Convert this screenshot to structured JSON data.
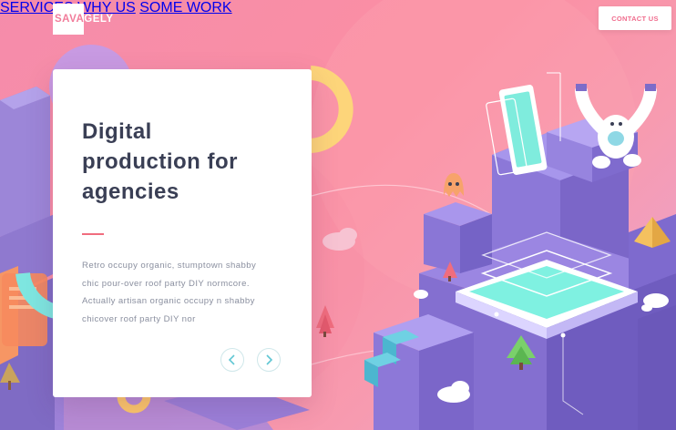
{
  "brand": {
    "logo_text": "SAVAGELY"
  },
  "nav": {
    "items": [
      "SERVICES",
      "WHY US",
      "SOME WORK"
    ],
    "cta": "CONTACT US"
  },
  "hero": {
    "headline_lines": [
      "Digital",
      "production for",
      "agencies"
    ],
    "body_lines": [
      "Retro occupy organic, stumptown shabby",
      "chic pour-over roof party DIY normcore.",
      "Actually artisan organic occupy n shabby",
      "chicover roof party DIY nor"
    ],
    "prev_icon": "chevron-left-icon",
    "next_icon": "chevron-right-icon"
  },
  "colors": {
    "accent": "#f06d8e",
    "teal": "#5fc6d3",
    "heading": "#3a3f55",
    "body": "#8a8f9f"
  }
}
